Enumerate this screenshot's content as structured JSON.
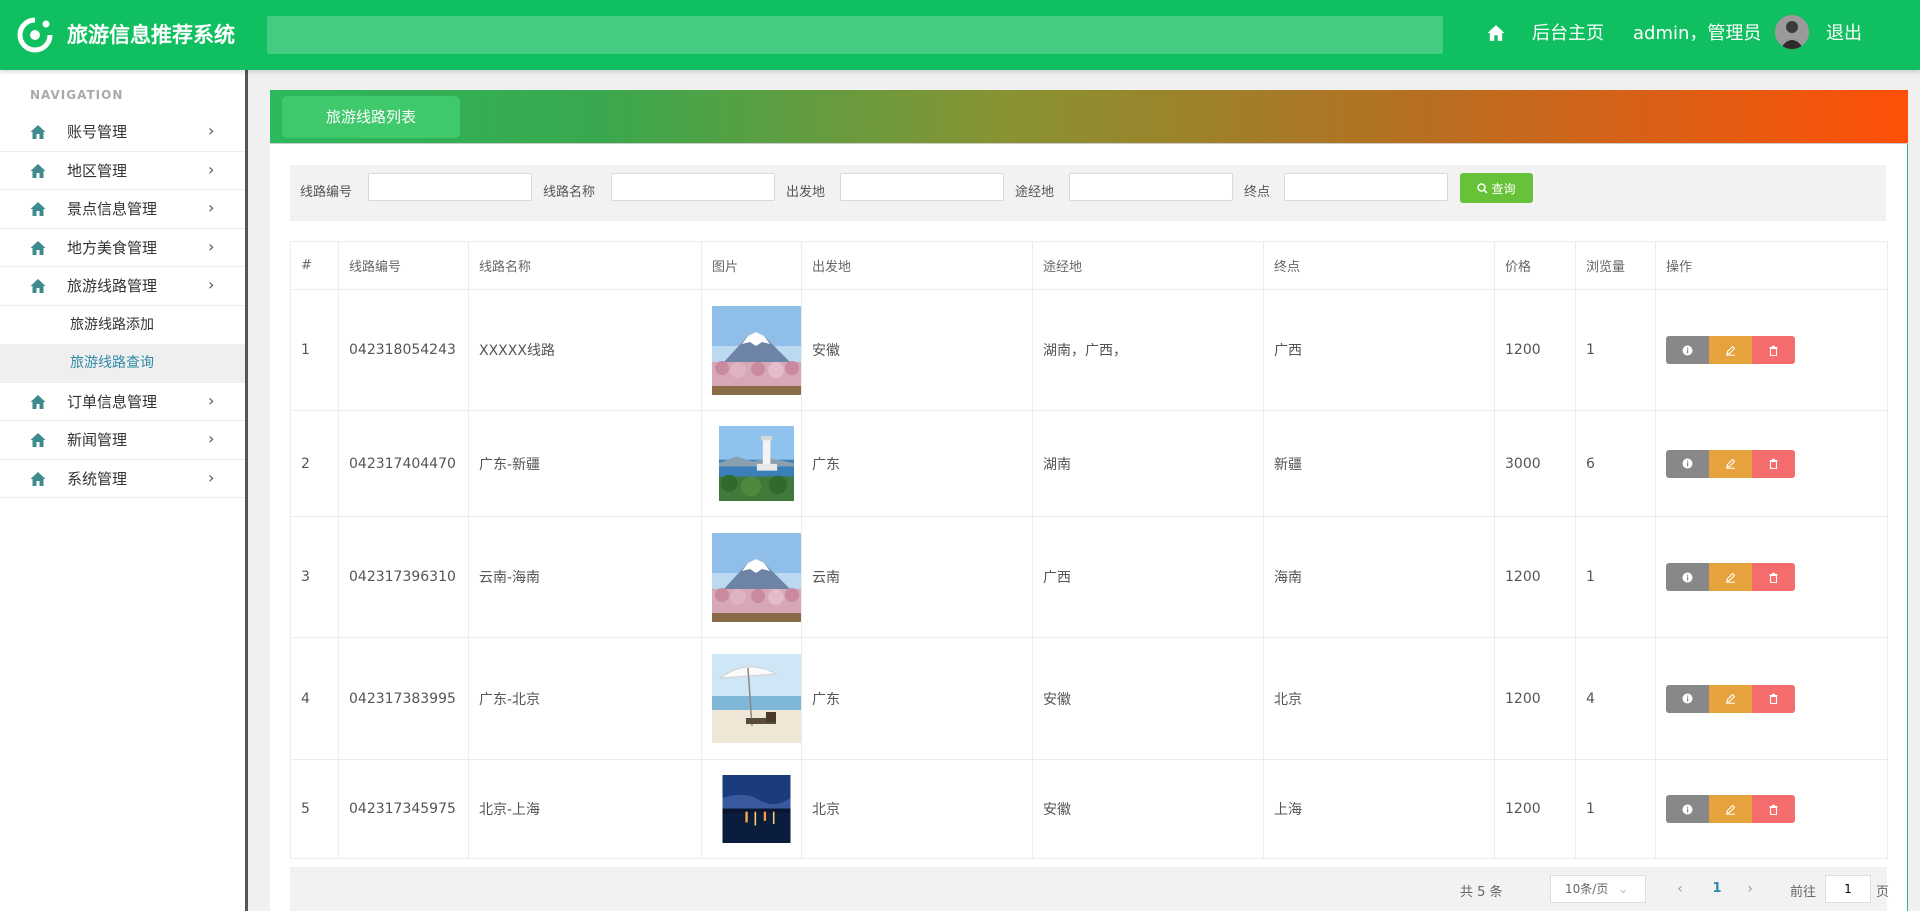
{
  "header": {
    "app_title": "旅游信息推荐系统",
    "home_label": "后台主页",
    "user_text": "admin，管理员",
    "logout_label": "退出"
  },
  "sidebar": {
    "nav_title": "NAVIGATION",
    "items": [
      {
        "label": "账号管理"
      },
      {
        "label": "地区管理"
      },
      {
        "label": "景点信息管理"
      },
      {
        "label": "地方美食管理"
      },
      {
        "label": "旅游线路管理"
      },
      {
        "label": "订单信息管理"
      },
      {
        "label": "新闻管理"
      },
      {
        "label": "系统管理"
      }
    ],
    "sub_items": [
      {
        "label": "旅游线路添加",
        "active": false
      },
      {
        "label": "旅游线路查询",
        "active": true
      }
    ]
  },
  "page": {
    "tab_title": "旅游线路列表"
  },
  "filters": {
    "route_no_label": "线路编号",
    "route_name_label": "线路名称",
    "departure_label": "出发地",
    "via_label": "途经地",
    "destination_label": "终点",
    "search_label": "查询"
  },
  "table": {
    "columns": [
      "#",
      "线路编号",
      "线路名称",
      "图片",
      "出发地",
      "途经地",
      "终点",
      "价格",
      "浏览量",
      "操作"
    ],
    "rows": [
      {
        "idx": "1",
        "code": "042318054243",
        "name": "XXXXX线路",
        "image": "mount-fuji-cherry",
        "from": "安徽",
        "via": "湖南，广西，",
        "to": "广西",
        "price": "1200",
        "views": "1"
      },
      {
        "idx": "2",
        "code": "042317404470",
        "name": "广东-新疆",
        "image": "lighthouse-sea",
        "from": "广东",
        "via": "湖南",
        "to": "新疆",
        "price": "3000",
        "views": "6"
      },
      {
        "idx": "3",
        "code": "042317396310",
        "name": "云南-海南",
        "image": "mount-fuji-cherry",
        "from": "云南",
        "via": "广西",
        "to": "海南",
        "price": "1200",
        "views": "1"
      },
      {
        "idx": "4",
        "code": "042317383995",
        "name": "广东-北京",
        "image": "beach-umbrella",
        "from": "广东",
        "via": "安徽",
        "to": "北京",
        "price": "1200",
        "views": "4"
      },
      {
        "idx": "5",
        "code": "042317345975",
        "name": "北京-上海",
        "image": "night-harbor",
        "from": "北京",
        "via": "安徽",
        "to": "上海",
        "price": "1200",
        "views": "1"
      }
    ]
  },
  "pagination": {
    "total_text": "共 5 条",
    "page_size": "10条/页",
    "current_page": "1",
    "goto_label": "前往",
    "goto_value": "1",
    "page_unit": "页"
  },
  "colors": {
    "brand": "#10bf5f",
    "search": "#67c23a",
    "op_view": "#888888",
    "op_edit": "#e6a23c",
    "op_delete": "#f56c6c"
  }
}
